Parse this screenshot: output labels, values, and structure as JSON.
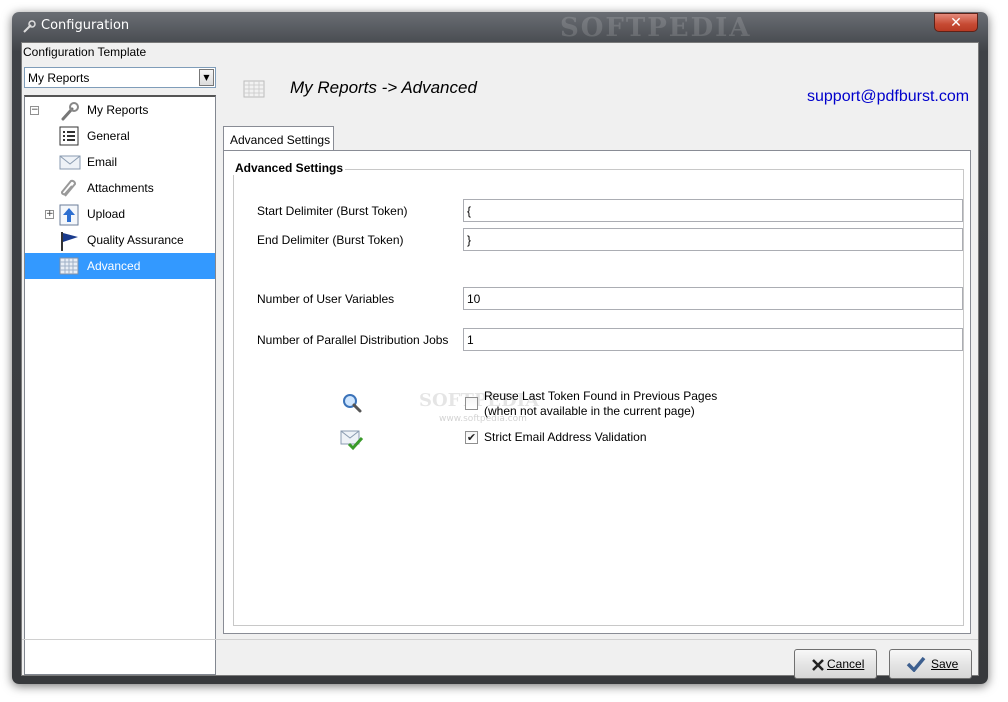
{
  "window": {
    "title": "Configuration",
    "watermark": "SOFTPEDIA",
    "close_label": "✕"
  },
  "template": {
    "label": "Configuration Template",
    "selected": "My Reports"
  },
  "tree": {
    "items": [
      {
        "label": "My Reports",
        "icon": "wrench-icon",
        "expander": "⊟",
        "selected": false
      },
      {
        "label": "General",
        "icon": "list-icon",
        "selected": false
      },
      {
        "label": "Email",
        "icon": "envelope-icon",
        "selected": false
      },
      {
        "label": "Attachments",
        "icon": "paperclip-icon",
        "selected": false
      },
      {
        "label": "Upload",
        "icon": "upload-arrow-icon",
        "expander": "⊞",
        "selected": false
      },
      {
        "label": "Quality Assurance",
        "icon": "flag-icon",
        "selected": false
      },
      {
        "label": "Advanced",
        "icon": "grid-icon",
        "selected": true
      }
    ]
  },
  "header": {
    "title": "My Reports -> Advanced",
    "support_email": "support@pdfburst.com"
  },
  "tab": {
    "label": "Advanced Settings"
  },
  "advanced": {
    "group_title": "Advanced Settings",
    "start_delimiter": {
      "label": "Start Delimiter (Burst Token)",
      "value": "{"
    },
    "end_delimiter": {
      "label": "End Delimiter (Burst Token)",
      "value": "}"
    },
    "user_variables": {
      "label": "Number of User Variables",
      "value": "10"
    },
    "parallel_jobs": {
      "label": "Number of Parallel Distribution Jobs",
      "value": "1"
    },
    "reuse_token": {
      "label_line1": "Reuse Last Token Found in Previous Pages",
      "label_line2": "(when not available in the current page)",
      "checked": false
    },
    "strict_email": {
      "label": "Strict Email Address Validation",
      "checked": true
    },
    "watermark": "SOFTPEDIA",
    "watermark_url": "www.softpedia.com"
  },
  "buttons": {
    "cancel": "Cancel",
    "save": "Save"
  },
  "colors": {
    "selection": "#3399ff",
    "support_link": "#0000cc",
    "title_bar": "#3f4247"
  }
}
